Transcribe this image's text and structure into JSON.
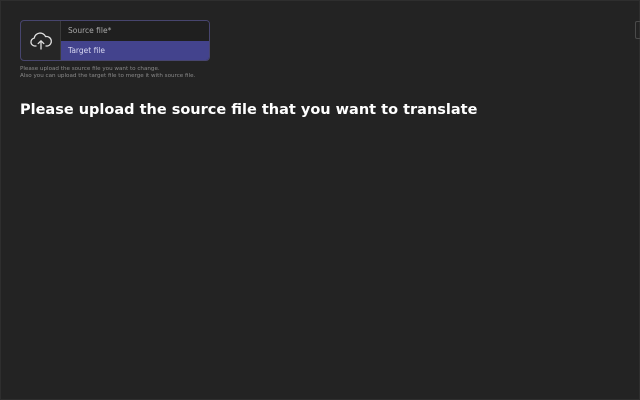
{
  "upload": {
    "icon": "cloud-upload-icon",
    "source_label": "Source file*",
    "target_label": "Target file",
    "help_line1": "Please upload the source file you want to change.",
    "help_line2": "Also you can upload the target file to merge it with source file."
  },
  "main": {
    "heading": "Please upload the source file that you want to translate"
  },
  "colors": {
    "background": "#232323",
    "accent": "#43438d",
    "widget_border": "#47456e"
  }
}
